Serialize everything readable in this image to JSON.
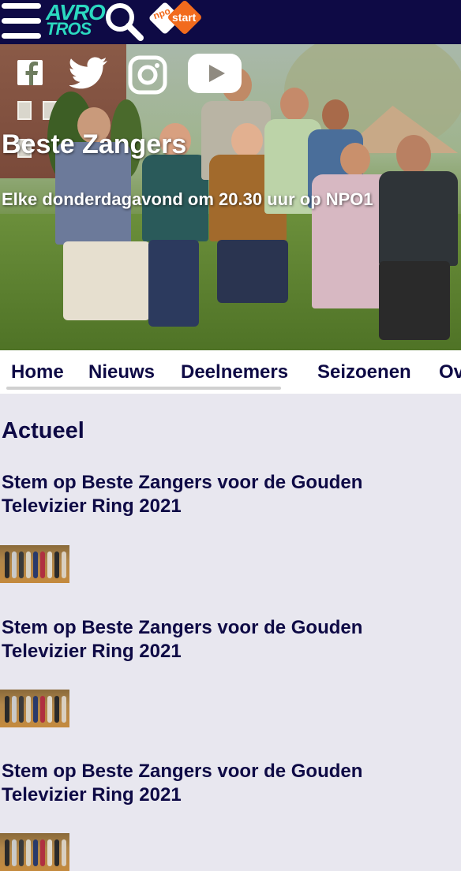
{
  "header": {
    "logo_line1": "AVRO",
    "logo_line2": "TROS",
    "npo_label": "npo",
    "start_label": "start"
  },
  "social": [
    "facebook-icon",
    "twitter-icon",
    "instagram-icon",
    "youtube-icon"
  ],
  "hero": {
    "title": "Beste Zangers",
    "subtitle": "Elke donderdagavond om 20.30 uur op NPO1"
  },
  "nav": {
    "items": [
      "Home",
      "Nieuws",
      "Deelnemers",
      "Seizoenen",
      "Ov"
    ]
  },
  "main": {
    "section_title": "Actueel",
    "articles": [
      {
        "title": "Stem op Beste Zangers voor de Gouden Televizier Ring 2021"
      },
      {
        "title": "Stem op Beste Zangers voor de Gouden Televizier Ring 2021"
      },
      {
        "title": "Stem op Beste Zangers voor de Gouden Televizier Ring 2021"
      }
    ]
  },
  "colors": {
    "header_bg": "#0e0a45",
    "text_dark": "#0e0a45",
    "accent_teal": "#2bd9c0",
    "npo_orange": "#f26b1d",
    "page_bg": "#e8e7ef"
  }
}
